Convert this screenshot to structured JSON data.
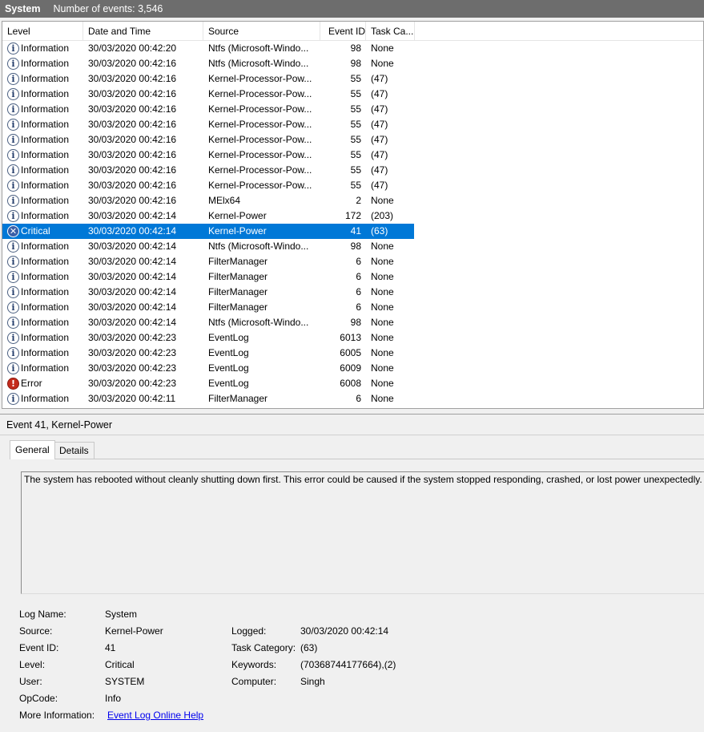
{
  "titlebar": {
    "log_name": "System",
    "count_text": "Number of events: 3,546"
  },
  "columns": {
    "level": "Level",
    "date": "Date and Time",
    "source": "Source",
    "event_id": "Event ID",
    "task": "Task Ca..."
  },
  "events": [
    {
      "level": "Information",
      "icon": "info-icon",
      "date": "30/03/2020 00:42:20",
      "source": "Ntfs (Microsoft-Windo...",
      "id": "98",
      "task": "None"
    },
    {
      "level": "Information",
      "icon": "info-icon",
      "date": "30/03/2020 00:42:16",
      "source": "Ntfs (Microsoft-Windo...",
      "id": "98",
      "task": "None"
    },
    {
      "level": "Information",
      "icon": "info-icon",
      "date": "30/03/2020 00:42:16",
      "source": "Kernel-Processor-Pow...",
      "id": "55",
      "task": "(47)"
    },
    {
      "level": "Information",
      "icon": "info-icon",
      "date": "30/03/2020 00:42:16",
      "source": "Kernel-Processor-Pow...",
      "id": "55",
      "task": "(47)"
    },
    {
      "level": "Information",
      "icon": "info-icon",
      "date": "30/03/2020 00:42:16",
      "source": "Kernel-Processor-Pow...",
      "id": "55",
      "task": "(47)"
    },
    {
      "level": "Information",
      "icon": "info-icon",
      "date": "30/03/2020 00:42:16",
      "source": "Kernel-Processor-Pow...",
      "id": "55",
      "task": "(47)"
    },
    {
      "level": "Information",
      "icon": "info-icon",
      "date": "30/03/2020 00:42:16",
      "source": "Kernel-Processor-Pow...",
      "id": "55",
      "task": "(47)"
    },
    {
      "level": "Information",
      "icon": "info-icon",
      "date": "30/03/2020 00:42:16",
      "source": "Kernel-Processor-Pow...",
      "id": "55",
      "task": "(47)"
    },
    {
      "level": "Information",
      "icon": "info-icon",
      "date": "30/03/2020 00:42:16",
      "source": "Kernel-Processor-Pow...",
      "id": "55",
      "task": "(47)"
    },
    {
      "level": "Information",
      "icon": "info-icon",
      "date": "30/03/2020 00:42:16",
      "source": "Kernel-Processor-Pow...",
      "id": "55",
      "task": "(47)"
    },
    {
      "level": "Information",
      "icon": "info-icon",
      "date": "30/03/2020 00:42:16",
      "source": "MElx64",
      "id": "2",
      "task": "None"
    },
    {
      "level": "Information",
      "icon": "info-icon",
      "date": "30/03/2020 00:42:14",
      "source": "Kernel-Power",
      "id": "172",
      "task": "(203)"
    },
    {
      "level": "Critical",
      "icon": "critical-icon",
      "date": "30/03/2020 00:42:14",
      "source": "Kernel-Power",
      "id": "41",
      "task": "(63)",
      "selected": true
    },
    {
      "level": "Information",
      "icon": "info-icon",
      "date": "30/03/2020 00:42:14",
      "source": "Ntfs (Microsoft-Windo...",
      "id": "98",
      "task": "None"
    },
    {
      "level": "Information",
      "icon": "info-icon",
      "date": "30/03/2020 00:42:14",
      "source": "FilterManager",
      "id": "6",
      "task": "None"
    },
    {
      "level": "Information",
      "icon": "info-icon",
      "date": "30/03/2020 00:42:14",
      "source": "FilterManager",
      "id": "6",
      "task": "None"
    },
    {
      "level": "Information",
      "icon": "info-icon",
      "date": "30/03/2020 00:42:14",
      "source": "FilterManager",
      "id": "6",
      "task": "None"
    },
    {
      "level": "Information",
      "icon": "info-icon",
      "date": "30/03/2020 00:42:14",
      "source": "FilterManager",
      "id": "6",
      "task": "None"
    },
    {
      "level": "Information",
      "icon": "info-icon",
      "date": "30/03/2020 00:42:14",
      "source": "Ntfs (Microsoft-Windo...",
      "id": "98",
      "task": "None"
    },
    {
      "level": "Information",
      "icon": "info-icon",
      "date": "30/03/2020 00:42:23",
      "source": "EventLog",
      "id": "6013",
      "task": "None"
    },
    {
      "level": "Information",
      "icon": "info-icon",
      "date": "30/03/2020 00:42:23",
      "source": "EventLog",
      "id": "6005",
      "task": "None"
    },
    {
      "level": "Information",
      "icon": "info-icon",
      "date": "30/03/2020 00:42:23",
      "source": "EventLog",
      "id": "6009",
      "task": "None"
    },
    {
      "level": "Error",
      "icon": "error-icon",
      "date": "30/03/2020 00:42:23",
      "source": "EventLog",
      "id": "6008",
      "task": "None"
    },
    {
      "level": "Information",
      "icon": "info-icon",
      "date": "30/03/2020 00:42:11",
      "source": "FilterManager",
      "id": "6",
      "task": "None"
    }
  ],
  "detail": {
    "title": "Event 41, Kernel-Power",
    "tabs": [
      "General",
      "Details"
    ],
    "description": "The system has rebooted without cleanly shutting down first. This error could be caused if the system stopped responding, crashed, or lost power unexpectedly.",
    "props": {
      "log_name_label": "Log Name:",
      "log_name": "System",
      "source_label": "Source:",
      "source": "Kernel-Power",
      "event_id_label": "Event ID:",
      "event_id": "41",
      "level_label": "Level:",
      "level": "Critical",
      "user_label": "User:",
      "user": "SYSTEM",
      "opcode_label": "OpCode:",
      "opcode": "Info",
      "more_info_label": "More Information:",
      "more_info_link": "Event Log Online Help",
      "logged_label": "Logged:",
      "logged": "30/03/2020 00:42:14",
      "task_label": "Task Category:",
      "task": "(63)",
      "keywords_label": "Keywords:",
      "keywords": "(70368744177664),(2)",
      "computer_label": "Computer:",
      "computer": "Singh"
    }
  },
  "colors": {
    "selection": "#0078d7",
    "titlebar": "#6d6d6d",
    "error": "#c42b1c",
    "critical": "#3a5fa8"
  }
}
